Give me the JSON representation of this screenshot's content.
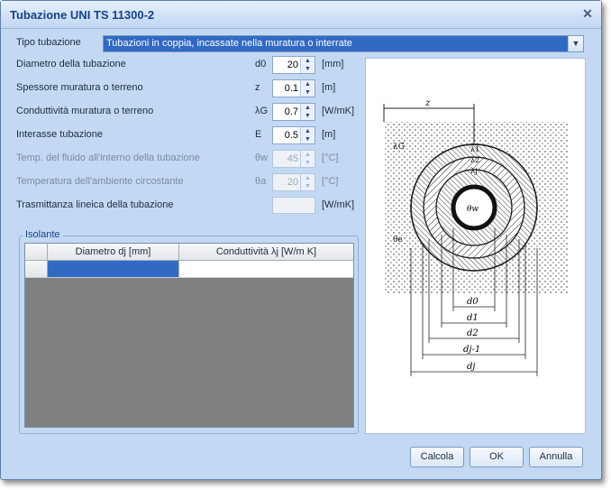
{
  "window": {
    "title": "Tubazione UNI TS 11300-2",
    "close_glyph": "✕"
  },
  "tipo": {
    "label": "Tipo tubazione",
    "value": "Tubazioni in coppia, incassate nella muratura o interrate"
  },
  "fields": [
    {
      "label": "Diametro della tubazione",
      "symbol": "d0",
      "value": "20",
      "unit": "[mm]",
      "enabled": true
    },
    {
      "label": "Spessore muratura o terreno",
      "symbol": "z",
      "value": "0.1",
      "unit": "[m]",
      "enabled": true
    },
    {
      "label": "Conduttività muratura o terreno",
      "symbol": "λG",
      "value": "0.7",
      "unit": "[W/mK]",
      "enabled": true
    },
    {
      "label": "Interasse tubazione",
      "symbol": "E",
      "value": "0.5",
      "unit": "[m]",
      "enabled": true
    },
    {
      "label": "Temp. del fluido  all'interno della tubazione",
      "symbol": "θw",
      "value": "45",
      "unit": "[°C]",
      "enabled": false
    },
    {
      "label": "Temperatura dell'ambiente circostante",
      "symbol": "θa",
      "value": "20",
      "unit": "[°C]",
      "enabled": false
    }
  ],
  "trasmittanza": {
    "label": "Trasmittanza lineica della tubazione",
    "unit": "[W/mK]",
    "value": ""
  },
  "isolante": {
    "title": "Isolante",
    "columns": [
      "Diametro dj [mm]",
      "Conduttività λj [W/m K]"
    ],
    "rows": [
      [
        "",
        ""
      ]
    ]
  },
  "diagram": {
    "labels": {
      "z": "z",
      "lambda_g": "λG",
      "theta_w": "θw",
      "theta_e": "θe",
      "lambda_1": "λ1",
      "lambda_2": "λ2",
      "lambda_3": "λj"
    },
    "dims": [
      "d0",
      "d1",
      "d2",
      "dj-1",
      "dj"
    ]
  },
  "buttons": {
    "calcola": "Calcola",
    "ok": "OK",
    "annulla": "Annulla"
  }
}
